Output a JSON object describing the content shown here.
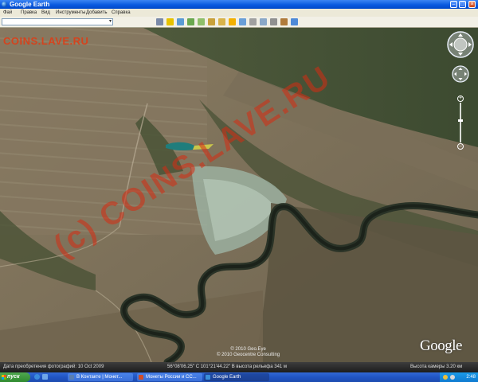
{
  "window": {
    "title": "Google Earth",
    "controls": {
      "minimize": "–",
      "maximize": "□",
      "close": "×"
    }
  },
  "menubar": {
    "items": [
      "Фай",
      "Правка",
      "Вид",
      "Инструменты",
      "Добавить",
      "Справка"
    ]
  },
  "search": {
    "value": "",
    "placeholder": ""
  },
  "toolbar": {
    "buttons": [
      {
        "icon": "sidebar-icon",
        "color": "#7a8aa8"
      },
      {
        "icon": "placemark-icon",
        "color": "#e6c200"
      },
      {
        "icon": "polygon-icon",
        "color": "#5b9bd5"
      },
      {
        "icon": "path-icon",
        "color": "#6aa84f"
      },
      {
        "icon": "overlay-icon",
        "color": "#8fbf6a"
      },
      {
        "icon": "tour-icon",
        "color": "#c9a13b"
      },
      {
        "icon": "historical-imagery-icon",
        "color": "#d9b34a"
      },
      {
        "icon": "sun-icon",
        "color": "#f3b000"
      },
      {
        "icon": "planets-icon",
        "color": "#6a9fd8"
      },
      {
        "icon": "ruler-icon",
        "color": "#a0a0a0"
      },
      {
        "icon": "email-icon",
        "color": "#8aa8c8"
      },
      {
        "icon": "print-icon",
        "color": "#909090"
      },
      {
        "icon": "save-image-icon",
        "color": "#b07b3b"
      },
      {
        "icon": "view-in-maps-icon",
        "color": "#4e8ad8"
      }
    ]
  },
  "map": {
    "watermark": "COINS.LAVE.RU",
    "overlay_watermark": "(c) COINS.LAVE.RU",
    "copyright_1": "© 2010 Geocentre Consulting",
    "copyright_2": "© 2010 Geo.Eye",
    "logo": "Google",
    "navigation": {
      "look_control_icon": "look-control-icon",
      "move_control_icon": "move-control-icon",
      "zoom_in": "+",
      "zoom_out": "–"
    }
  },
  "statusbar": {
    "imagery_date": "Дата преобретения фотографий: 10 Oct 2009",
    "coordinates": "56°08'06.25\" С    101°21'44.22\" В    высота рельефа 341 м",
    "eye_alt": "Высота камеры    3.20 км"
  },
  "taskbar": {
    "start_label": "пуск",
    "tasks": [
      {
        "label": "В Контакте | Монет...",
        "color": "#5a7fb3"
      },
      {
        "label": "Монеты России и СС...",
        "color": "#d04d2a"
      },
      {
        "label": "Google Earth",
        "color": "#3a8fd8",
        "active": true
      }
    ],
    "clock": "2:48"
  }
}
